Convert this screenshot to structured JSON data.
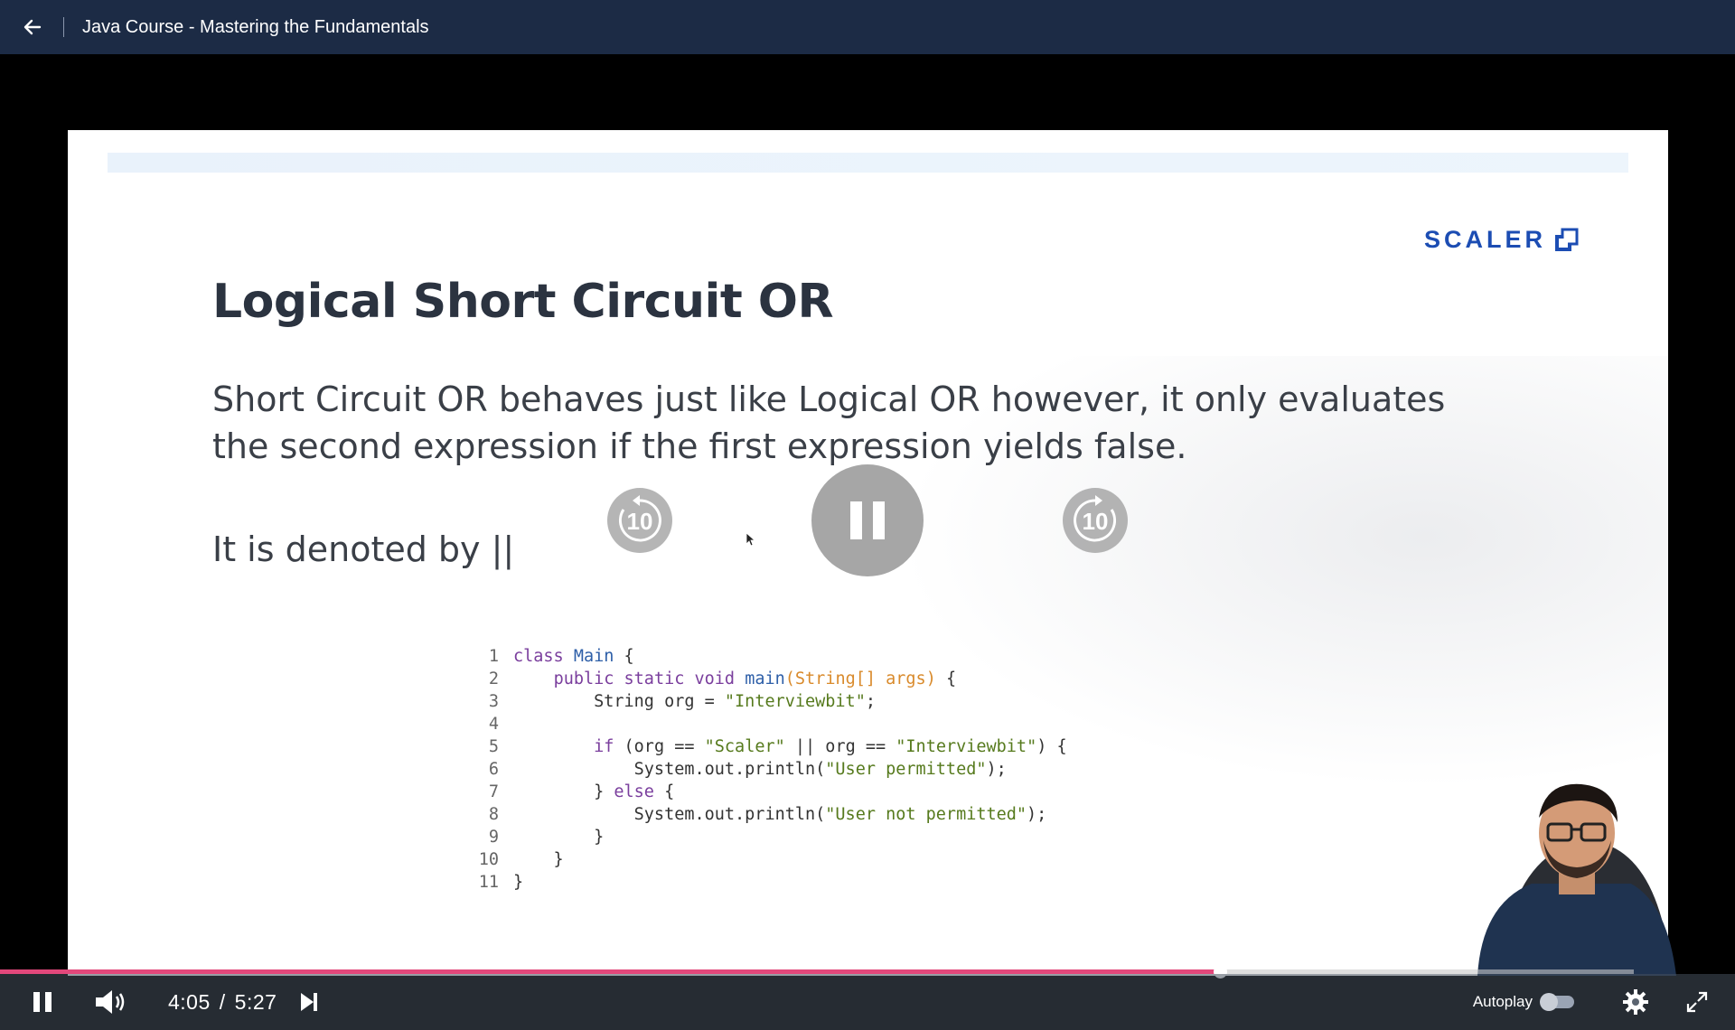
{
  "topbar": {
    "course_title": "Java Course - Mastering the Fundamentals",
    "back_icon": "arrow-left-icon"
  },
  "slide": {
    "logo_text": "SCALER",
    "title": "Logical Short Circuit OR",
    "body_line1": "Short Circuit OR behaves just like Logical OR however, it only evaluates",
    "body_line2": "the second expression if the first expression yields false.",
    "denoted": "It is denoted by ||",
    "code_lines": [
      {
        "n": "1",
        "text": "class Main {"
      },
      {
        "n": "2",
        "text": "    public static void main(String[] args) {"
      },
      {
        "n": "3",
        "text": "        String org = \"Interviewbit\";"
      },
      {
        "n": "4",
        "text": ""
      },
      {
        "n": "5",
        "text": "        if (org == \"Scaler\" || org == \"Interviewbit\") {"
      },
      {
        "n": "6",
        "text": "            System.out.println(\"User permitted\");"
      },
      {
        "n": "7",
        "text": "        } else {"
      },
      {
        "n": "8",
        "text": "            System.out.println(\"User not permitted\");"
      },
      {
        "n": "9",
        "text": "        }"
      },
      {
        "n": "10",
        "text": "    }"
      },
      {
        "n": "11",
        "text": "}"
      }
    ]
  },
  "overlay": {
    "rewind_label": "10",
    "forward_label": "10"
  },
  "player": {
    "current_time": "4:05",
    "separator": "/",
    "duration": "5:27",
    "progress_fraction": 0.7468,
    "autoplay_label": "Autoplay",
    "autoplay_on": false,
    "accent_color": "#e2487b"
  }
}
